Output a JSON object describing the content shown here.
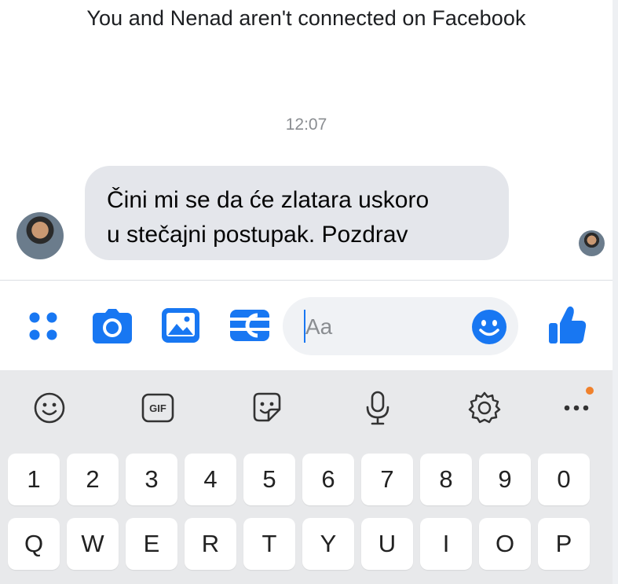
{
  "conversation": {
    "connection_notice": "You and Nenad aren't connected on Facebook",
    "timestamp": "12:07",
    "message": {
      "line1": "Čini mi se da će zlatara uskoro",
      "line2": "u stečajni postupak. Pozdrav"
    }
  },
  "composer": {
    "placeholder": "Aa",
    "actions": [
      "menu-icon",
      "camera-icon",
      "gallery-icon",
      "payment-icon"
    ],
    "accent_color": "#1877f2"
  },
  "keyboard_toolbar": {
    "items": [
      "emoji-icon",
      "GIF",
      "sticker-icon",
      "microphone-icon",
      "settings-icon",
      "more-icon"
    ],
    "gif_label": "GIF",
    "notification_dot_color": "#f0812c"
  },
  "keyboard": {
    "number_row": [
      "1",
      "2",
      "3",
      "4",
      "5",
      "6",
      "7",
      "8",
      "9",
      "0"
    ],
    "letter_row": [
      "Q",
      "W",
      "E",
      "R",
      "T",
      "Y",
      "U",
      "I",
      "O",
      "P"
    ]
  }
}
